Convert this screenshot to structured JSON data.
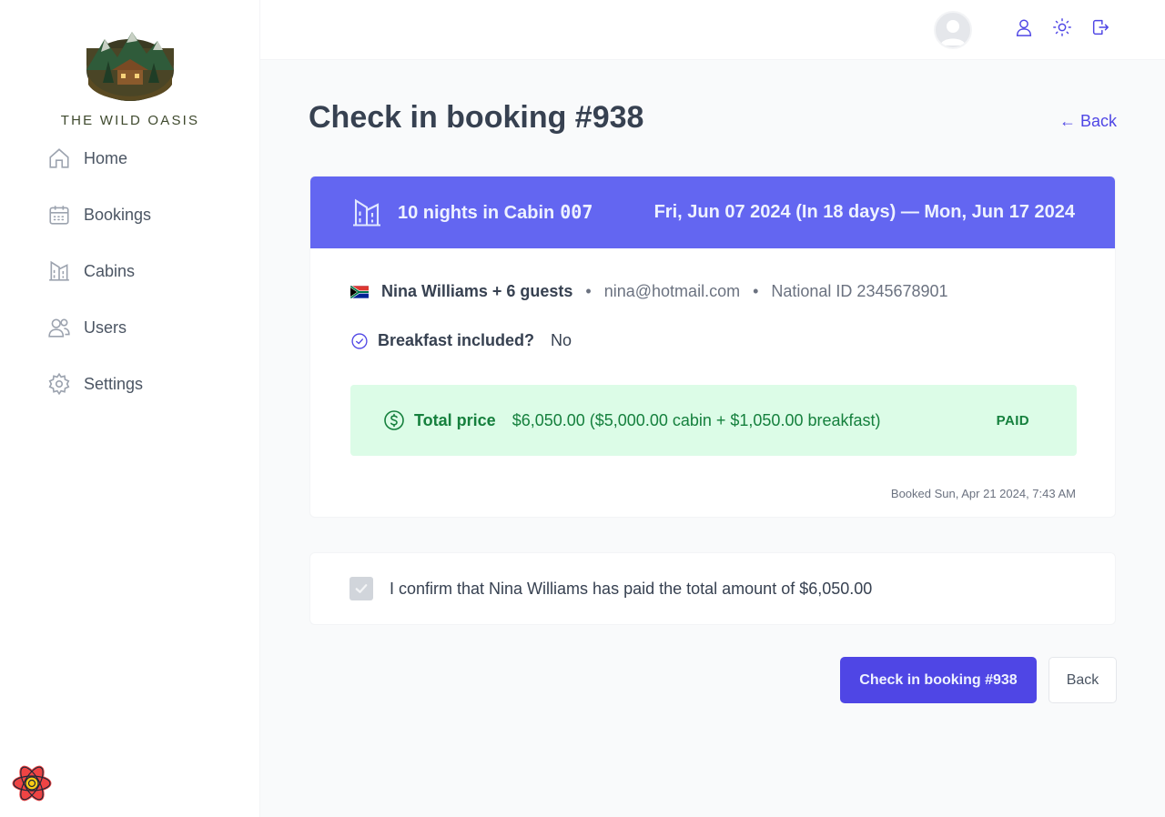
{
  "sidebar": {
    "brand": "THE WILD OASIS",
    "items": [
      {
        "label": "Home",
        "icon": "home-icon"
      },
      {
        "label": "Bookings",
        "icon": "calendar-icon"
      },
      {
        "label": "Cabins",
        "icon": "building-icon"
      },
      {
        "label": "Users",
        "icon": "users-icon"
      },
      {
        "label": "Settings",
        "icon": "gear-icon"
      }
    ]
  },
  "header": {
    "icons": [
      "user-icon",
      "sun-icon",
      "logout-icon"
    ],
    "accent": "#4f46e5"
  },
  "main": {
    "title": "Check in booking #938",
    "back_link": "← Back",
    "booking": {
      "nights_text": "10 nights in Cabin",
      "cabin": "007",
      "dates": "Fri, Jun 07 2024 (In 18 days) — Mon, Jun 17 2024",
      "guest": "Nina Williams + 6 guests",
      "email": "nina@hotmail.com",
      "national_id": "National ID 2345678901",
      "breakfast_label": "Breakfast included?",
      "breakfast_value": "No",
      "price_label": "Total price",
      "price_value": "$6,050.00 ($5,000.00 cabin + $1,050.00 breakfast)",
      "status": "PAID",
      "booked_at": "Booked Sun, Apr 21 2024, 7:43 AM",
      "header_color": "#6366f1",
      "paid_color": "#dcfce7"
    },
    "confirm_text": "I confirm that Nina Williams has paid the total amount of $6,050.00",
    "confirm_checked": true,
    "primary_button": "Check in booking #938",
    "secondary_button": "Back"
  }
}
